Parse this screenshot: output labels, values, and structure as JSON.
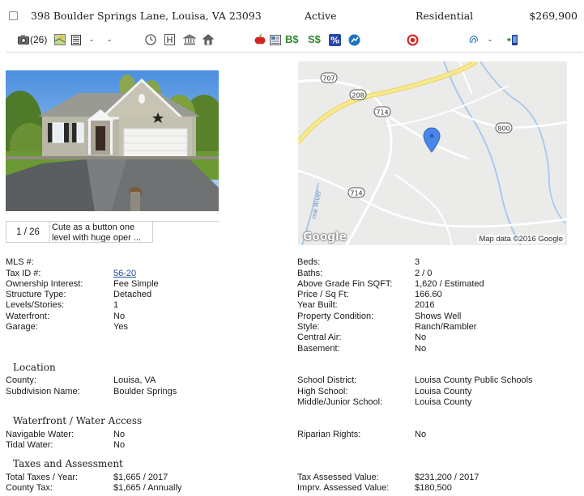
{
  "header": {
    "address": "398 Boulder Springs Lane, Louisa, VA 23093",
    "status": "Active",
    "property_type": "Residential",
    "price": "$269,900"
  },
  "toolbar": {
    "photo_count": "(26)",
    "dash1": "-",
    "dash2": "-",
    "dash3": "-"
  },
  "gallery": {
    "counter": "1 / 26",
    "caption": "Cute as a button one level with huge oper ..."
  },
  "map": {
    "logo": "Google",
    "credit": "Map data ©2016 Google",
    "road_labels": [
      "707",
      "208",
      "714",
      "714",
      "800"
    ],
    "river_label": "me River"
  },
  "details_left": [
    {
      "label": "MLS #:",
      "value": ""
    },
    {
      "label": "Tax ID #:",
      "value": "56-20"
    },
    {
      "label": "Ownership Interest:",
      "value": "Fee Simple"
    },
    {
      "label": "Structure Type:",
      "value": "Detached"
    },
    {
      "label": "Levels/Stories:",
      "value": "1"
    },
    {
      "label": "Waterfront:",
      "value": "No"
    },
    {
      "label": "Garage:",
      "value": "Yes"
    }
  ],
  "details_right": [
    {
      "label": "Beds:",
      "value": "3"
    },
    {
      "label": "Baths:",
      "value": "2 / 0"
    },
    {
      "label": "Above Grade Fin SQFT:",
      "value": "1,620 / Estimated"
    },
    {
      "label": "Price / Sq Ft:",
      "value": "166.60"
    },
    {
      "label": "Year Built:",
      "value": "2016"
    },
    {
      "label": "Property Condition:",
      "value": "Shows Well"
    },
    {
      "label": "Style:",
      "value": "Ranch/Rambler"
    },
    {
      "label": "Central Air:",
      "value": "No"
    },
    {
      "label": "Basement:",
      "value": "No"
    }
  ],
  "location": {
    "title": "Location",
    "county_label": "County:",
    "county": "Louisa, VA",
    "subdivision_label": "Subdivision Name:",
    "subdivision": "Boulder Springs",
    "school_district_label": "School District:",
    "school_district": "Louisa County Public Schools",
    "high_school_label": "High School:",
    "high_school": "Louisa County",
    "middle_school_label": "Middle/Junior School:",
    "middle_school": "Louisa County"
  },
  "waterfront": {
    "title": "Waterfront / Water Access",
    "navigable_label": "Navigable Water:",
    "navigable": "No",
    "tidal_label": "Tidal Water:",
    "tidal": "No",
    "riparian_label": "Riparian Rights:",
    "riparian": "No"
  },
  "taxes": {
    "title": "Taxes and Assessment",
    "total_label": "Total Taxes / Year:",
    "total": "$1,665 / 2017",
    "county_tax_label": "County Tax:",
    "county_tax": "$1,665 / Annually",
    "assessed_label": "Tax Assessed Value:",
    "assessed": "$231,200 / 2017",
    "imprv_label": "Imprv. Assessed Value:",
    "imprv": "$180,500"
  },
  "colors": {
    "link": "#1f4f9e",
    "map_pin": "#4a86e8",
    "map_water": "#9fc3e8",
    "map_road_major": "#f7e07a"
  },
  "icons": [
    "checkbox",
    "camera-icon",
    "map-thumbnail-icon",
    "document-list-icon",
    "clock-icon",
    "hotel-icon",
    "bank-icon",
    "school-icon",
    "apple-icon",
    "newspaper-icon",
    "buyer-dollar-icon",
    "seller-dollar-icon",
    "percent-icon",
    "chart-circle-icon",
    "target-icon",
    "fingerprint-icon",
    "mobile-phone-icon"
  ]
}
